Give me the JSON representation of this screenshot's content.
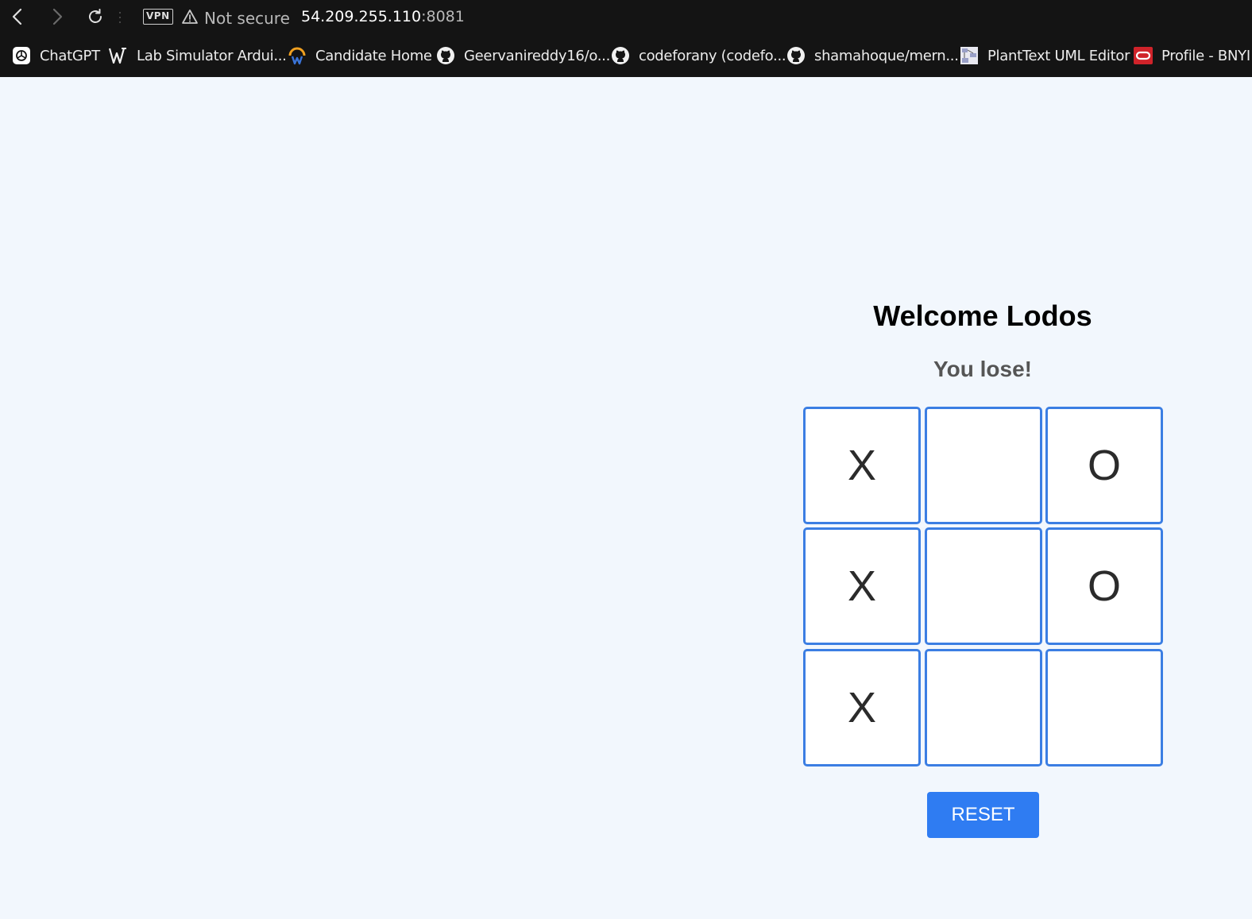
{
  "browser": {
    "vpn_label": "VPN",
    "security_label": "Not secure",
    "url_host": "54.209.255.110",
    "url_port": ":8081",
    "bookmarks": [
      {
        "label": "ChatGPT",
        "icon": "chatgpt-icon"
      },
      {
        "label": "Lab Simulator Ardui...",
        "icon": "wokwi-icon"
      },
      {
        "label": "Candidate Home",
        "icon": "candidate-icon"
      },
      {
        "label": "Geervanireddy16/o...",
        "icon": "github-icon"
      },
      {
        "label": "codeforany (codefo...",
        "icon": "github-icon"
      },
      {
        "label": "shamahoque/mern...",
        "icon": "github-icon"
      },
      {
        "label": "PlantText UML Editor",
        "icon": "planttext-icon"
      },
      {
        "label": "Profile - BNYI",
        "icon": "oracle-icon"
      }
    ]
  },
  "game": {
    "title": "Welcome Lodos",
    "status": "You lose!",
    "board": [
      [
        "X",
        "",
        "O"
      ],
      [
        "X",
        "",
        "O"
      ],
      [
        "X",
        "",
        ""
      ]
    ],
    "reset_label": "RESET"
  },
  "colors": {
    "page_background": "#f2f7fd",
    "cell_border": "#3b7ee3",
    "reset_button": "#2f7cf2",
    "chrome_background": "#141414"
  }
}
